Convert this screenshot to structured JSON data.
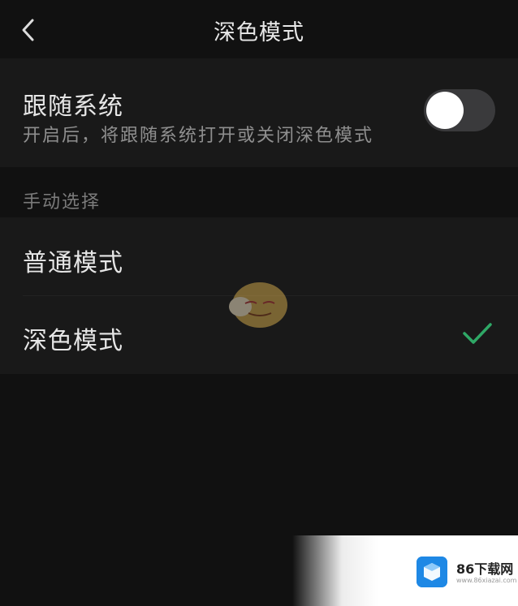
{
  "header": {
    "title": "深色模式",
    "back_icon": "chevron-left-icon"
  },
  "follow_system": {
    "title": "跟随系统",
    "description": "开启后，将跟随系统打开或关闭深色模式",
    "toggle_on": false
  },
  "manual": {
    "section_label": "手动选择",
    "options": [
      {
        "label": "普通模式",
        "selected": false
      },
      {
        "label": "深色模式",
        "selected": true
      }
    ],
    "check_icon": "checkmark-icon"
  },
  "watermark": {
    "brand": "86下载网",
    "url": "www.86xiazai.com"
  },
  "colors": {
    "background": "#111111",
    "panel": "#191919",
    "accent_check": "#2fa866",
    "toggle_off": "#3a3a3c"
  }
}
